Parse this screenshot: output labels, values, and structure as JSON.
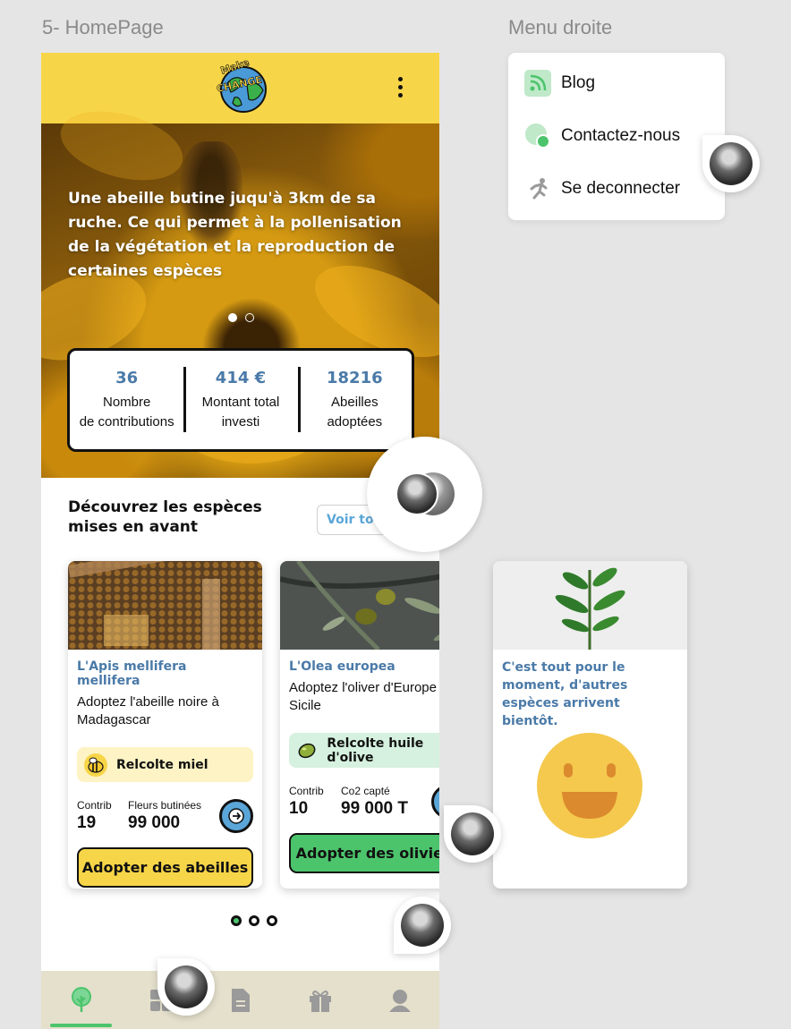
{
  "frame_labels": {
    "home": "5- HomePage",
    "menu": "Menu droite"
  },
  "header": {
    "logo_text_1": "Make",
    "logo_text_2": "CHANGE"
  },
  "hero": {
    "text": "Une abeille butine juqu'à 3km de sa ruche. Ce qui permet à la pollenisation de la végétation et la reproduction de certaines espèces",
    "slides_total": 2,
    "slide_active": 1
  },
  "stats": [
    {
      "value": "36",
      "label_line1": "Nombre",
      "label_line2": "de contributions"
    },
    {
      "value": "414 €",
      "label_line1": "Montant total",
      "label_line2": "investi"
    },
    {
      "value": "18216",
      "label_line1": "Abeilles",
      "label_line2": "adoptées"
    }
  ],
  "section": {
    "title": "Découvrez les espèces mises en avant",
    "see_all": "Voir tout"
  },
  "cards": [
    {
      "scientific_name": "L'Apis mellifera mellifera",
      "description": "Adoptez l'abeille noire à Madagascar",
      "tag": "Relcolte miel",
      "tag_color": "#fdf3c4",
      "stat1_label": "Contrib",
      "stat1_value": "19",
      "stat2_label": "Fleurs butinées",
      "stat2_value": "99 000",
      "cta": "Adopter des abeilles",
      "cta_color": "#f7d548"
    },
    {
      "scientific_name": "L'Olea europea",
      "description": "Adoptez l'oliver d'Europe en Sicile",
      "tag": "Relcolte huile d'olive",
      "tag_color": "#d6f1df",
      "stat1_label": "Contrib",
      "stat1_value": "10",
      "stat2_label": "Co2 capté",
      "stat2_value": "99 000 T",
      "cta": "Adopter des oliviers",
      "cta_color": "#4cc46c"
    }
  ],
  "end_card": {
    "text": "C'est tout pour le moment, d'autres espèces arrivent bientôt."
  },
  "pager": {
    "total": 3,
    "active": 1
  },
  "tabbar": [
    {
      "icon": "tree-icon",
      "active": true
    },
    {
      "icon": "grid-icon",
      "active": false
    },
    {
      "icon": "document-icon",
      "active": false
    },
    {
      "icon": "gift-icon",
      "active": false
    },
    {
      "icon": "profile-icon",
      "active": false
    }
  ],
  "menu": {
    "items": [
      {
        "label": "Blog",
        "icon": "rss-icon"
      },
      {
        "label": "Contactez-nous",
        "icon": "chat-icon"
      },
      {
        "label": "Se deconnecter",
        "icon": "runner-icon"
      }
    ]
  },
  "colors": {
    "primary_yellow": "#f7d548",
    "accent_blue": "#4a7aa8",
    "accent_green": "#4cc46c",
    "tabbar_bg": "#e4e0cc"
  }
}
